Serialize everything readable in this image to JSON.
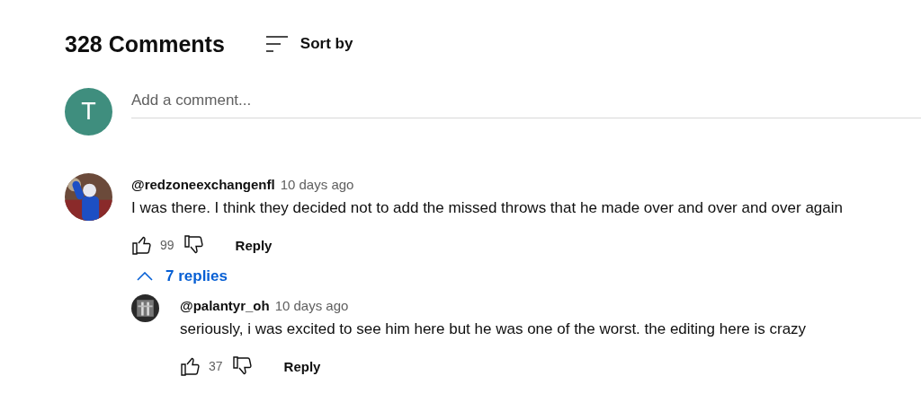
{
  "header": {
    "count": "328 Comments",
    "sort_label": "Sort by"
  },
  "composer": {
    "avatar_letter": "T",
    "placeholder": "Add a comment..."
  },
  "comments": [
    {
      "author": "@redzoneexchangenfl",
      "time": "10 days ago",
      "text": "I was there. I think they decided not to add the missed throws that he made over and over and over again",
      "likes": "99",
      "reply_label": "Reply",
      "replies_toggle": {
        "label": "7 replies",
        "expanded": true
      },
      "replies": [
        {
          "author": "@palantyr_oh",
          "time": "10 days ago",
          "text": "seriously, i was excited to see him here but he was one of the worst. the editing here is crazy",
          "likes": "37",
          "reply_label": "Reply"
        }
      ]
    }
  ]
}
